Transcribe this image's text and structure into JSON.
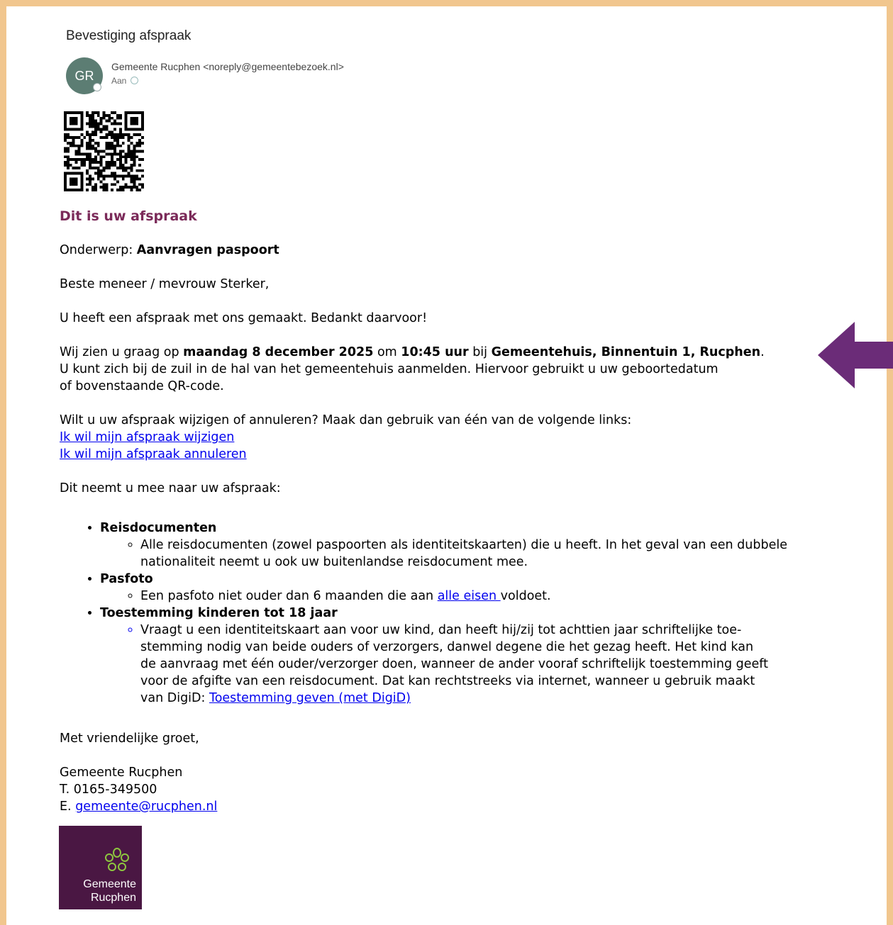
{
  "email": {
    "subject": "Bevestiging afspraak",
    "sender": {
      "initials": "GR",
      "display": "Gemeente Rucphen <noreply@gemeentebezoek.nl>",
      "avatar_color": "#5C7D73"
    },
    "to_label": "Aan"
  },
  "body": {
    "heading": "Dit is uw afspraak",
    "subject_label": "Onderwerp: ",
    "subject_value": "Aanvragen paspoort",
    "greeting": "Beste meneer / mevrouw Sterker,",
    "thanks": "U heeft een afspraak met ons gemaakt. Bedankt daarvoor!",
    "appointment": {
      "intro": "Wij zien u graag op ",
      "date": "maandag 8 december 2025",
      "at": " om ",
      "time": "10:45 uur",
      "bij": " bij ",
      "location": "Gemeentehuis, Binnentuin 1, Rucphen",
      "period": ".",
      "line2": "U kunt zich bij de zuil in de hal van het gemeentehuis aanmelden. Hiervoor gebruikt u uw geboortedatum",
      "line3": "of bovenstaande QR-code."
    },
    "change_intro": "Wilt u uw afspraak wijzigen of annuleren? Maak dan gebruik van één van de volgende links:",
    "link_change": "Ik wil mijn afspraak wijzigen",
    "link_cancel": "Ik wil mijn afspraak annuleren",
    "bring_intro": "Dit neemt u mee naar uw afspraak:",
    "items": [
      {
        "title": "Reisdocumenten",
        "text": "Alle reisdocumenten (zowel paspoorten als identiteitskaarten) die u heeft. In het geval van een dubbele nationaliteit neemt u ook uw buitenlandse reisdocument mee."
      },
      {
        "title": "Pasfoto",
        "text_before": "Een pasfoto niet ouder dan 6 maanden die aan ",
        "link": "alle eisen ",
        "text_after": "voldoet."
      },
      {
        "title": "Toestemming kinderen tot 18 jaar",
        "text_lines": [
          "Vraagt u een identiteitskaart aan voor uw kind, dan heeft hij/zij tot achttien jaar schriftelijke toe-",
          "stemming nodig van beide ouders of verzorgers, danwel degene die het gezag heeft. Het kind kan",
          "de aanvraag met één ouder/verzorger doen, wanneer de ander vooraf schriftelijk toestemming geeft",
          "voor de afgifte van een reisdocument. Dat kan rechtstreeks via internet, wanneer u gebruik maakt"
        ],
        "text_last": "van DigiD: ",
        "link": "Toestemming geven (met DigiD)"
      }
    ],
    "closing": "Met vriendelijke groet,",
    "signature": {
      "org": "Gemeente Rucphen",
      "phone": "T. 0165-349500",
      "email_prefix": "E. ",
      "email": "gemeente@rucphen.nl"
    }
  },
  "logo": {
    "line1": "Gemeente",
    "line2": "Rucphen",
    "color": "#4A1743"
  },
  "colors": {
    "frame": "#F1C68E",
    "heading": "#7B2A59",
    "link": "#0000EE",
    "arrow": "#6B2C78"
  }
}
